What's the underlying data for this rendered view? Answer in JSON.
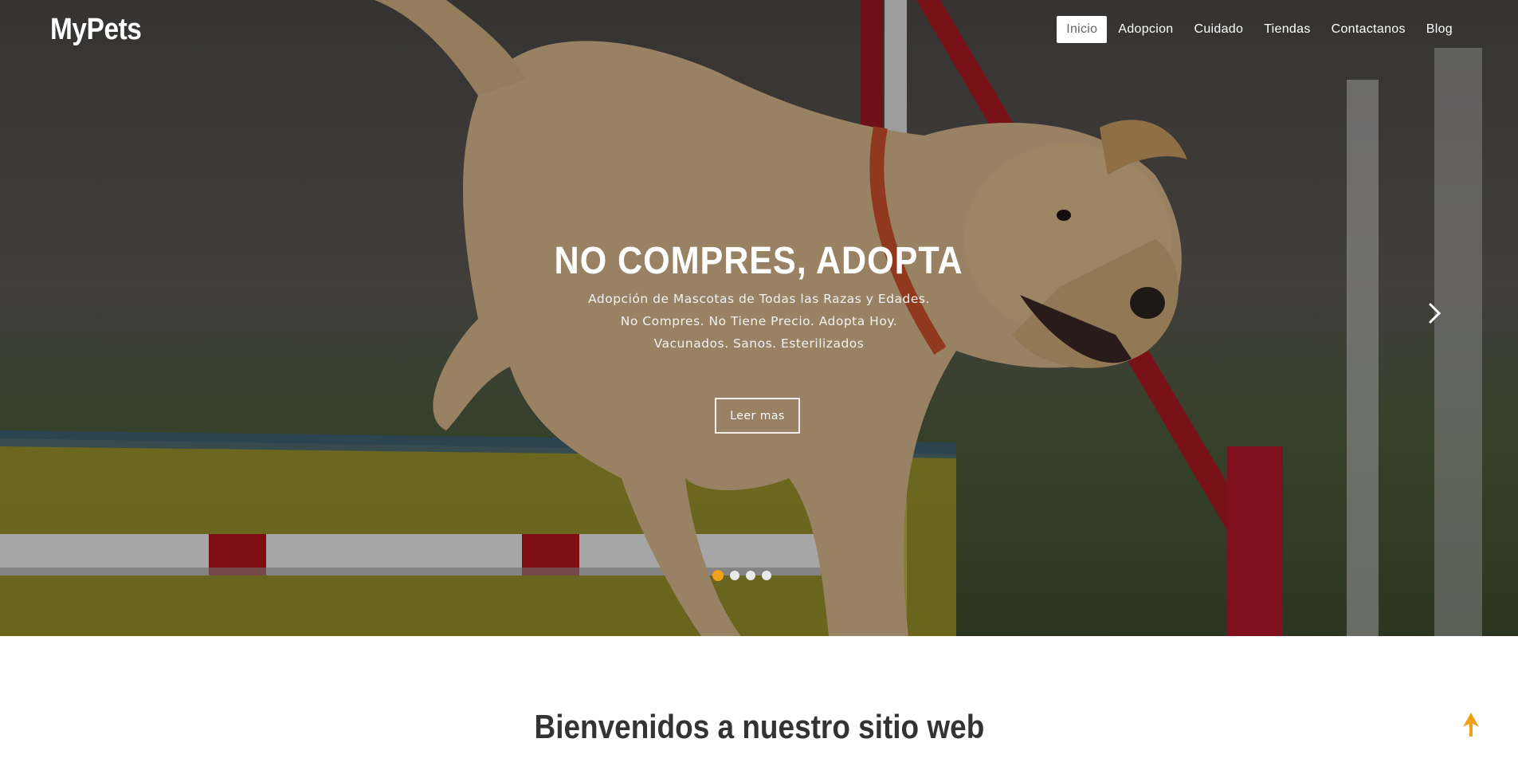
{
  "brand": {
    "name": "MyPets"
  },
  "nav": {
    "items": [
      {
        "label": "Inicio",
        "active": true
      },
      {
        "label": "Adopcion",
        "active": false
      },
      {
        "label": "Cuidado",
        "active": false
      },
      {
        "label": "Tiendas",
        "active": false
      },
      {
        "label": "Contactanos",
        "active": false
      },
      {
        "label": "Blog",
        "active": false
      }
    ]
  },
  "slide": {
    "title": "NO COMPRES, ADOPTA",
    "lines": [
      "Adopción de Mascotas de Todas las Razas y Edades.",
      "No Compres. No Tiene Precio. Adopta Hoy.",
      "Vacunados. Sanos. Esterilizados"
    ],
    "button_label": "Leer mas",
    "image": "labrador-dog-jumping-agility-hurdle",
    "dots": {
      "count": 4,
      "active": 1
    }
  },
  "icons": {
    "next": "chevron-right-icon",
    "back_to_top": "arrow-up-icon"
  },
  "colors": {
    "accent": "#f0a019",
    "heading": "#333333",
    "nav_active_bg": "#ffffff"
  },
  "section": {
    "heading": "Bienvenidos a nuestro sitio web"
  }
}
